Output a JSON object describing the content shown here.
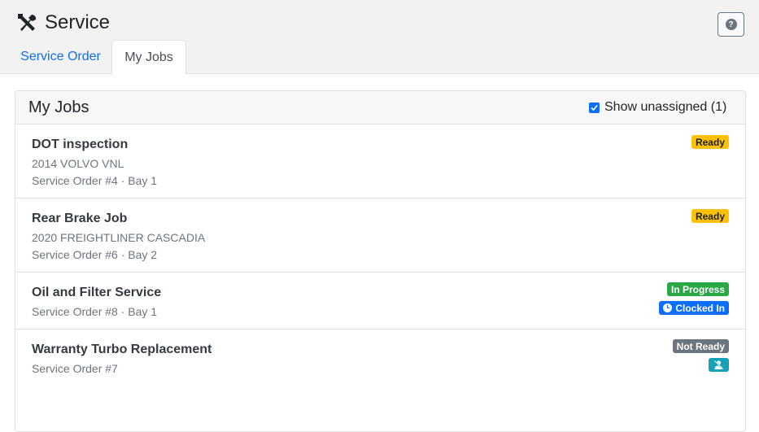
{
  "app": {
    "title": "Service"
  },
  "tabs": [
    {
      "label": "Service Order"
    },
    {
      "label": "My Jobs"
    }
  ],
  "help": {
    "label": "?"
  },
  "card": {
    "title": "My Jobs",
    "show_unassigned_label": "Show unassigned (1)",
    "show_unassigned_checked": true
  },
  "jobs": [
    {
      "name": "DOT inspection",
      "vehicle": "2014 VOLVO VNL",
      "order": "Service Order #4 · Bay 1",
      "status": "Ready"
    },
    {
      "name": "Rear Brake Job",
      "vehicle": "2020 FREIGHTLINER CASCADIA",
      "order": "Service Order #6 · Bay 2",
      "status": "Ready"
    },
    {
      "name": "Oil and Filter Service",
      "order": "Service Order #8 · Bay 1",
      "status": "In Progress",
      "clock": "Clocked In"
    },
    {
      "name": "Warranty Turbo Replacement",
      "order": "Service Order #7",
      "status": "Not Ready",
      "extra_icon": "unassigned-user-icon"
    }
  ],
  "colors": {
    "ready": "#ffc107",
    "in_progress": "#28a745",
    "clocked_in": "#0d6efd",
    "not_ready": "#6c757d",
    "unassigned": "#17a2b8"
  }
}
